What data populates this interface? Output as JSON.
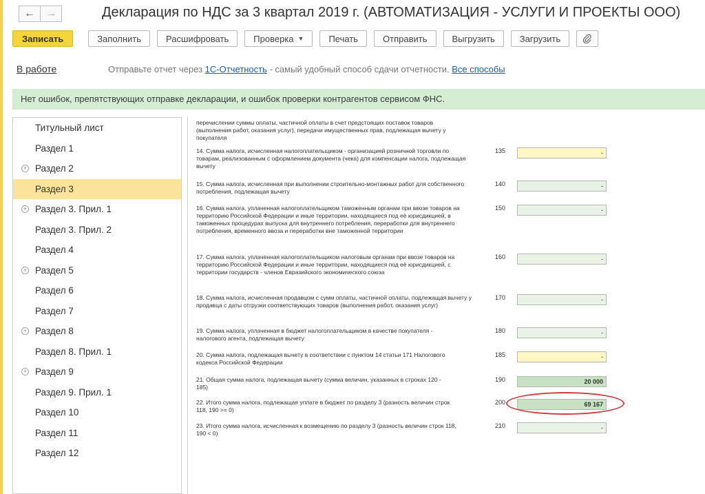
{
  "nav": {
    "back_icon": "arrow-left-icon",
    "forward_icon": "arrow-right-icon"
  },
  "title": "Декларация по НДС за 3 квартал 2019 г. (АВТОМАТИЗАЦИЯ - УСЛУГИ И ПРОЕКТЫ ООО)",
  "toolbar": {
    "save_label": "Записать",
    "fill_label": "Заполнить",
    "decode_label": "Расшифровать",
    "check_label": "Проверка",
    "print_label": "Печать",
    "send_label": "Отправить",
    "export_label": "Выгрузить",
    "import_label": "Загрузить",
    "attach_icon": "paperclip-icon"
  },
  "status": {
    "state": "В работе",
    "msg_prefix": "Отправьте отчет через ",
    "msg_link": "1С-Отчетность",
    "msg_suffix": " - самый удобный способ сдачи отчетности. ",
    "all_methods": "Все способы"
  },
  "banner": "Нет ошибок, препятствующих отправке декларации, и ошибок проверки контрагентов сервисом ФНС.",
  "colors": {
    "accent": "#f5d43a",
    "banner_bg": "#d4edd3",
    "active_item": "#fbe49a",
    "highlight_ring": "#d33a3a"
  },
  "sidebar": {
    "items": [
      {
        "label": "Титульный лист"
      },
      {
        "label": "Раздел 1"
      },
      {
        "label": "Раздел 2"
      },
      {
        "label": "Раздел 3"
      },
      {
        "label": "Раздел 3. Прил. 1"
      },
      {
        "label": "Раздел 3. Прил. 2"
      },
      {
        "label": "Раздел 4"
      },
      {
        "label": "Раздел 5"
      },
      {
        "label": "Раздел 6"
      },
      {
        "label": "Раздел 7"
      },
      {
        "label": "Раздел 8"
      },
      {
        "label": "Раздел 8. Прил. 1"
      },
      {
        "label": "Раздел 9"
      },
      {
        "label": "Раздел 9. Прил. 1"
      },
      {
        "label": "Раздел 10"
      },
      {
        "label": "Раздел 11"
      },
      {
        "label": "Раздел 12"
      }
    ]
  },
  "rows": [
    {
      "text": "перечислении суммы оплаты, частичной оплаты в счет предстоящих поставок товаров (выполнения работ, оказания услуг), передачи имущественных прав, подлежащая вычету у покупателя"
    },
    {
      "text": "14. Сумма налога, исчисленная налогоплательщиком - организацией розничной торговли по товарам, реализованным с оформлением документа (чека) для компенсации налога, подлежащая вычету",
      "code": "135",
      "value": "-"
    },
    {
      "text": "15. Сумма налога, исчисленная при выполнении строительно-монтажных работ для собственного потребления, подлежащая вычету",
      "code": "140",
      "value": "-"
    },
    {
      "text": "16. Сумма налога, уплаченная налогоплательщиком таможенным органам при ввозе товаров на территорию Российской Федерации и иные территории, находящиеся под её юрисдикцией, в таможенных процедурах выпуска для внутреннего потребления, переработки для внутреннего потребления, временного ввоза и переработки вне таможенной территории",
      "code": "150",
      "value": "-"
    },
    {
      "text": "17. Сумма налога, уплаченная налогоплательщиком налоговым органам при ввозе товаров на территорию Российской Федерации и иные территории, находящиеся под её юрисдикцией, с территории государств - членов Евразийского экономического союза",
      "code": "160",
      "value": "-"
    },
    {
      "text": "18. Сумма налога, исчисленная продавцом с сумм оплаты, частичной оплаты, подлежащая вычету у продавца с даты отгрузки соответствующих товаров (выполнения работ, оказания услуг)",
      "code": "170",
      "value": "-"
    },
    {
      "text": "19. Сумма налога, уплаченная в бюджет налогоплательщиком в качестве покупателя - налогового агента, подлежащая вычету",
      "code": "180",
      "value": "-"
    },
    {
      "text": "20. Сумма налога, подлежащая вычету в соответствии с пунктом 14 статьи 171 Налогового кодекса Российской Федерации",
      "code": "185",
      "value": "-"
    },
    {
      "text": "21. Общая сумма налога, подлежащая вычету (сумма величин, указанных в строках 120 - 185)",
      "code": "190",
      "value": "20 000"
    },
    {
      "text": "22. Итого сумма налога, подлежащая уплате в бюджет по разделу 3 (разность величин строк 118, 190 >= 0)",
      "code": "200",
      "value": "69 167"
    },
    {
      "text": "23. Итого сумма налога, исчисленная к возмещению по разделу 3 (разность величин строк 118, 190 < 0)",
      "code": "210",
      "value": "-"
    }
  ]
}
